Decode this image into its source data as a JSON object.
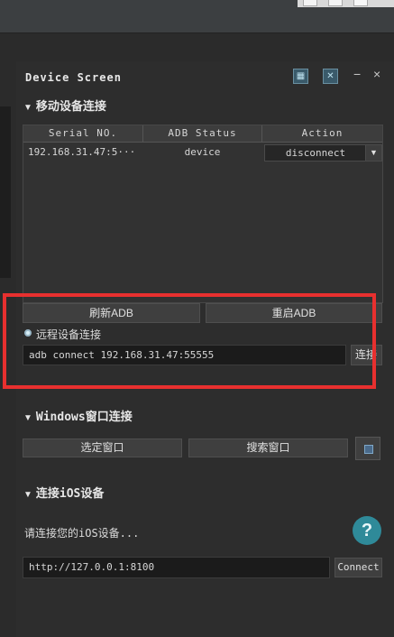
{
  "panel": {
    "title": "Device Screen",
    "close_label": "×",
    "minimize_label": "−"
  },
  "mobile_section": {
    "title": "移动设备连接",
    "table": {
      "headers": [
        "Serial NO.",
        "ADB Status",
        "Action"
      ],
      "rows": [
        {
          "serial": "192.168.31.47:5···",
          "status": "device",
          "action": "disconnect"
        }
      ]
    },
    "refresh_adb_label": "刷新ADB",
    "restart_adb_label": "重启ADB",
    "remote_label": "远程设备连接",
    "remote_input_value": "adb connect 192.168.31.47:55555",
    "connect_label": "连接"
  },
  "windows_section": {
    "title": "Windows窗口连接",
    "select_window_label": "选定窗口",
    "search_window_label": "搜索窗口"
  },
  "ios_section": {
    "title": "连接iOS设备",
    "prompt": "请连接您的iOS设备...",
    "help_label": "?",
    "url_value": "http://127.0.0.1:8100",
    "connect_label": "Connect"
  },
  "colors": {
    "highlight_border": "#e8302f",
    "accent": "#2f8a99"
  }
}
